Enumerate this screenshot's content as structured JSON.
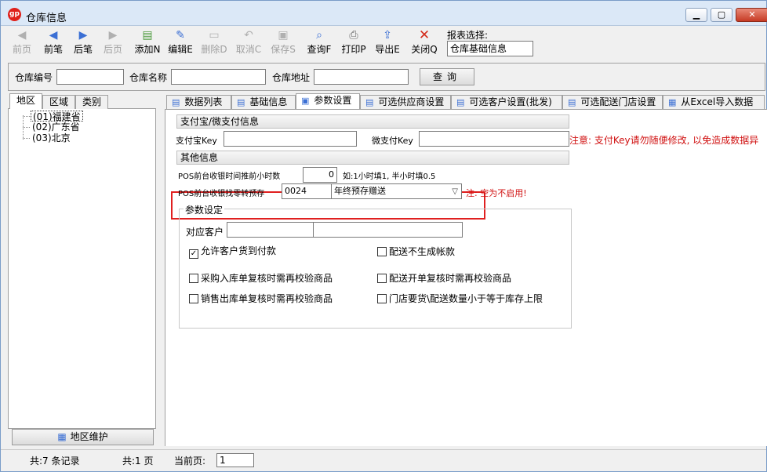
{
  "window": {
    "title": "仓库信息",
    "logo_text": "gp"
  },
  "toolbar": {
    "buttons": [
      {
        "label": "前页",
        "icon": "double-left-arrow-icon",
        "glyph": "◀",
        "enabled": false
      },
      {
        "label": "前笔",
        "icon": "left-arrow-icon",
        "glyph": "◀",
        "enabled": true
      },
      {
        "label": "后笔",
        "icon": "right-arrow-icon",
        "glyph": "▶",
        "enabled": true
      },
      {
        "label": "后页",
        "icon": "double-right-arrow-icon",
        "glyph": "▶",
        "enabled": false
      },
      {
        "label": "添加N",
        "icon": "add-document-icon",
        "glyph": "▤",
        "enabled": true
      },
      {
        "label": "编辑E",
        "icon": "edit-document-icon",
        "glyph": "✎",
        "enabled": true
      },
      {
        "label": "删除D",
        "icon": "delete-document-icon",
        "glyph": "▭",
        "enabled": false
      },
      {
        "label": "取消C",
        "icon": "undo-icon",
        "glyph": "↶",
        "enabled": false
      },
      {
        "label": "保存S",
        "icon": "save-icon",
        "glyph": "▣",
        "enabled": false
      },
      {
        "label": "查询F",
        "icon": "search-document-icon",
        "glyph": "⌕",
        "enabled": true
      },
      {
        "label": "打印P",
        "icon": "printer-icon",
        "glyph": "⎙",
        "enabled": true
      },
      {
        "label": "导出E",
        "icon": "export-folder-icon",
        "glyph": "⇪",
        "enabled": true
      },
      {
        "label": "关闭Q",
        "icon": "close-x-icon",
        "glyph": "✕",
        "enabled": true
      }
    ],
    "report_label": "报表选择:",
    "report_value": "仓库基础信息"
  },
  "search": {
    "code_label": "仓库编号",
    "name_label": "仓库名称",
    "address_label": "仓库地址",
    "query_button": "查询"
  },
  "left": {
    "tabs": [
      "地区",
      "区域",
      "类别"
    ],
    "tree": [
      "(01)福建省",
      "(02)广东省",
      "(03)北京"
    ],
    "maintain_button": "地区维护"
  },
  "right": {
    "tabs": [
      "数据列表",
      "基础信息",
      "参数设置",
      "可选供应商设置",
      "可选客户设置(批发)",
      "可选配送门店设置",
      "从Excel导入数据"
    ],
    "payment_section": "支付宝/微支付信息",
    "alipay_label": "支付宝Key",
    "wechat_label": "微支付Key",
    "key_warning": "注意: 支付Key请勿随便修改, 以免造成数据异",
    "other_section": "其他信息",
    "advance_hours_label": "POS前台收银时间推前小时数",
    "advance_hours_value": "0",
    "advance_hours_hint": "如:1小时填1, 半小时填0.5",
    "change_deposit_label": "POS前台收银找零转预存",
    "change_deposit_code": "0024",
    "change_deposit_name": "年终预存赠送",
    "change_deposit_note": "注: 空为不启用!",
    "param_group_title": "参数设定",
    "customer_label": "对应客户",
    "checkboxes": [
      {
        "label": "允许客户货到付款",
        "checked": true
      },
      {
        "label": "配送不生成帐款",
        "checked": false
      },
      {
        "label": "采购入库单复核时需再校验商品",
        "checked": false
      },
      {
        "label": "配送开单复核时需再校验商品",
        "checked": false
      },
      {
        "label": "销售出库单复核时需再校验商品",
        "checked": false
      },
      {
        "label": "门店要货\\配送数量小于等于库存上限",
        "checked": false
      }
    ]
  },
  "status": {
    "records": "共:7 条记录",
    "pages": "共:1 页",
    "current_label": "当前页:",
    "current_value": "1"
  }
}
